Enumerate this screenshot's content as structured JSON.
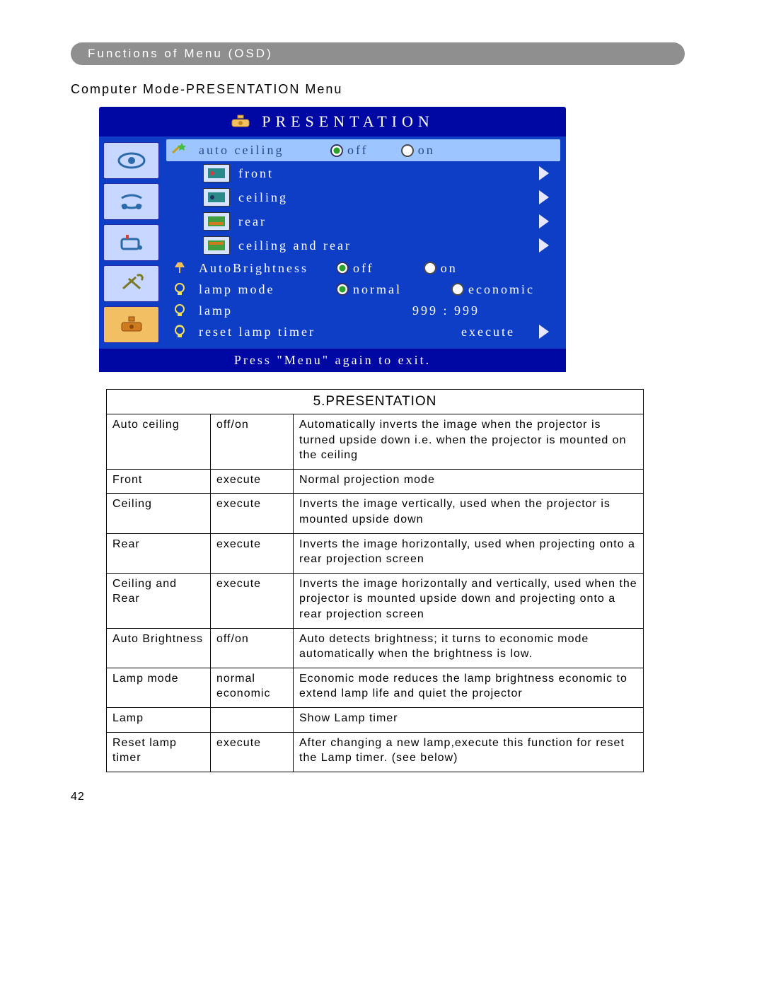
{
  "header": {
    "pill": "Functions of Menu (OSD)"
  },
  "subtitle": "Computer Mode-PRESENTATION Menu",
  "osd": {
    "title": "PRESENTATION",
    "footer": "Press \"Menu\" again to exit.",
    "auto_ceiling": {
      "label": "auto ceiling",
      "off": "off",
      "on": "on"
    },
    "modes": {
      "front": "front",
      "ceiling": "ceiling",
      "rear": "rear",
      "ceiling_rear": "ceiling and rear"
    },
    "auto_brightness": {
      "label": "AutoBrightness",
      "off": "off",
      "on": "on"
    },
    "lamp_mode": {
      "label": "lamp mode",
      "normal": "normal",
      "economic": "economic"
    },
    "lamp": {
      "label": "lamp",
      "value": "999 : 999"
    },
    "reset": {
      "label": "reset lamp timer",
      "action": "execute"
    }
  },
  "table": {
    "title": "5.PRESENTATION",
    "rows": [
      {
        "name": "Auto ceiling",
        "opt": "off/on",
        "desc": "Automatically inverts the image when the projector is turned upside down i.e. when the projector is mounted on the ceiling"
      },
      {
        "name": "Front",
        "opt": "execute",
        "desc": "Normal projection mode"
      },
      {
        "name": "Ceiling",
        "opt": "execute",
        "desc": "Inverts the image vertically, used when the projector is mounted upside down"
      },
      {
        "name": "Rear",
        "opt": "execute",
        "desc": "Inverts the image horizontally, used when projecting onto a rear projection screen"
      },
      {
        "name": "Ceiling and Rear",
        "opt": "execute",
        "desc": "Inverts the image horizontally and vertically, used when the projector is mounted upside down and projecting onto a rear projection screen"
      },
      {
        "name": "Auto Brightness",
        "opt": "off/on",
        "desc": "Auto detects brightness; it turns to economic mode automatically when the brightness is low."
      },
      {
        "name": "Lamp mode",
        "opt": "normal economic",
        "desc": "Economic mode reduces the lamp brightness economic to extend lamp life and quiet the projector"
      },
      {
        "name": "Lamp",
        "opt": "",
        "desc": "Show Lamp timer"
      },
      {
        "name": "Reset lamp timer",
        "opt": "execute",
        "desc": "After changing a new lamp,execute this function for reset the Lamp timer. (see below)"
      }
    ]
  },
  "page_number": "42"
}
